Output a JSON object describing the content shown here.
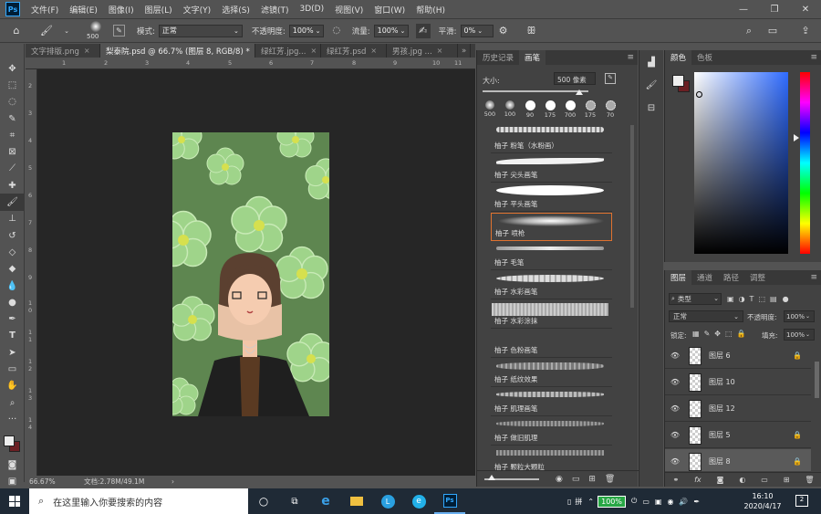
{
  "app": {
    "logo": "Ps"
  },
  "menu": [
    "文件(F)",
    "编辑(E)",
    "图像(I)",
    "图层(L)",
    "文字(Y)",
    "选择(S)",
    "滤镜(T)",
    "3D(D)",
    "视图(V)",
    "窗口(W)",
    "帮助(H)"
  ],
  "window_controls": {
    "minimize": "—",
    "restore": "❐",
    "close": "✕"
  },
  "options": {
    "brush_size": "500",
    "mode_label": "模式:",
    "mode_value": "正常",
    "opacity_label": "不透明度:",
    "opacity_value": "100%",
    "flow_label": "流量:",
    "flow_value": "100%",
    "smoothing_label": "平滑:",
    "smoothing_value": "0%"
  },
  "tabs": [
    {
      "label": "文字排版.png"
    },
    {
      "label": "梨泰院.psd @ 66.7% (图层 8, RGB/8) *"
    },
    {
      "label": "绿红芳.jpg..."
    },
    {
      "label": "绿红芳.psd"
    },
    {
      "label": "男孩.jpg ..."
    }
  ],
  "tab_overflow": "»",
  "ruler_top": [
    "1",
    "2",
    "3",
    "4",
    "5",
    "6",
    "7",
    "8",
    "9",
    "10",
    "11"
  ],
  "ruler_left": [
    "2",
    "3",
    "4",
    "5",
    "6",
    "7",
    "8",
    "9",
    "1",
    "0",
    "1",
    "1",
    "1",
    "2",
    "1",
    "3",
    "1",
    "4"
  ],
  "status": {
    "zoom": "66.67%",
    "doc": "文档:2.78M/49.1M",
    "arrow": "›"
  },
  "brush_panel": {
    "tab_history": "历史记录",
    "tab_brush": "画笔",
    "size_label": "大小:",
    "size_value": "500 像素",
    "presets": [
      "500",
      "100",
      "90",
      "175",
      "700",
      "175",
      "70"
    ],
    "brushes": [
      "柚子 粉笔（水粉画）",
      "柚子 尖头画笔",
      "柚子 平头画笔",
      "柚子 喷枪",
      "柚子 毛笔",
      "柚子 水彩画笔",
      "柚子 水彩涂抹",
      "柚子 色粉画笔",
      "柚子 纸纹效果",
      "柚子 肌理画笔",
      "柚子 做旧肌理",
      "柚子 颗粒大颗粒"
    ],
    "selected_index": 3
  },
  "color_panel": {
    "tab_color": "颜色",
    "tab_swatches": "色板",
    "hue_color": "#2f6bff"
  },
  "layers_panel": {
    "tab_layers": "图层",
    "tab_channels": "通道",
    "tab_paths": "路径",
    "tab_adjust": "调整",
    "filter_label": "类型",
    "blend_mode": "正常",
    "opacity_label": "不透明度:",
    "opacity_value": "100%",
    "lock_label": "锁定:",
    "fill_label": "填充:",
    "fill_value": "100%",
    "layers": [
      {
        "name": "图层 6",
        "locked": true
      },
      {
        "name": "图层 10",
        "locked": false
      },
      {
        "name": "图层 12",
        "locked": false
      },
      {
        "name": "图层 5",
        "locked": true
      },
      {
        "name": "图层 8",
        "locked": true
      }
    ],
    "selected_layer": "图层 8"
  },
  "taskbar": {
    "search_placeholder": "在这里输入你要搜索的内容",
    "battery": "100%",
    "ime": "拼",
    "time": "16:10",
    "date": "2020/4/17",
    "notification_count": "2"
  }
}
